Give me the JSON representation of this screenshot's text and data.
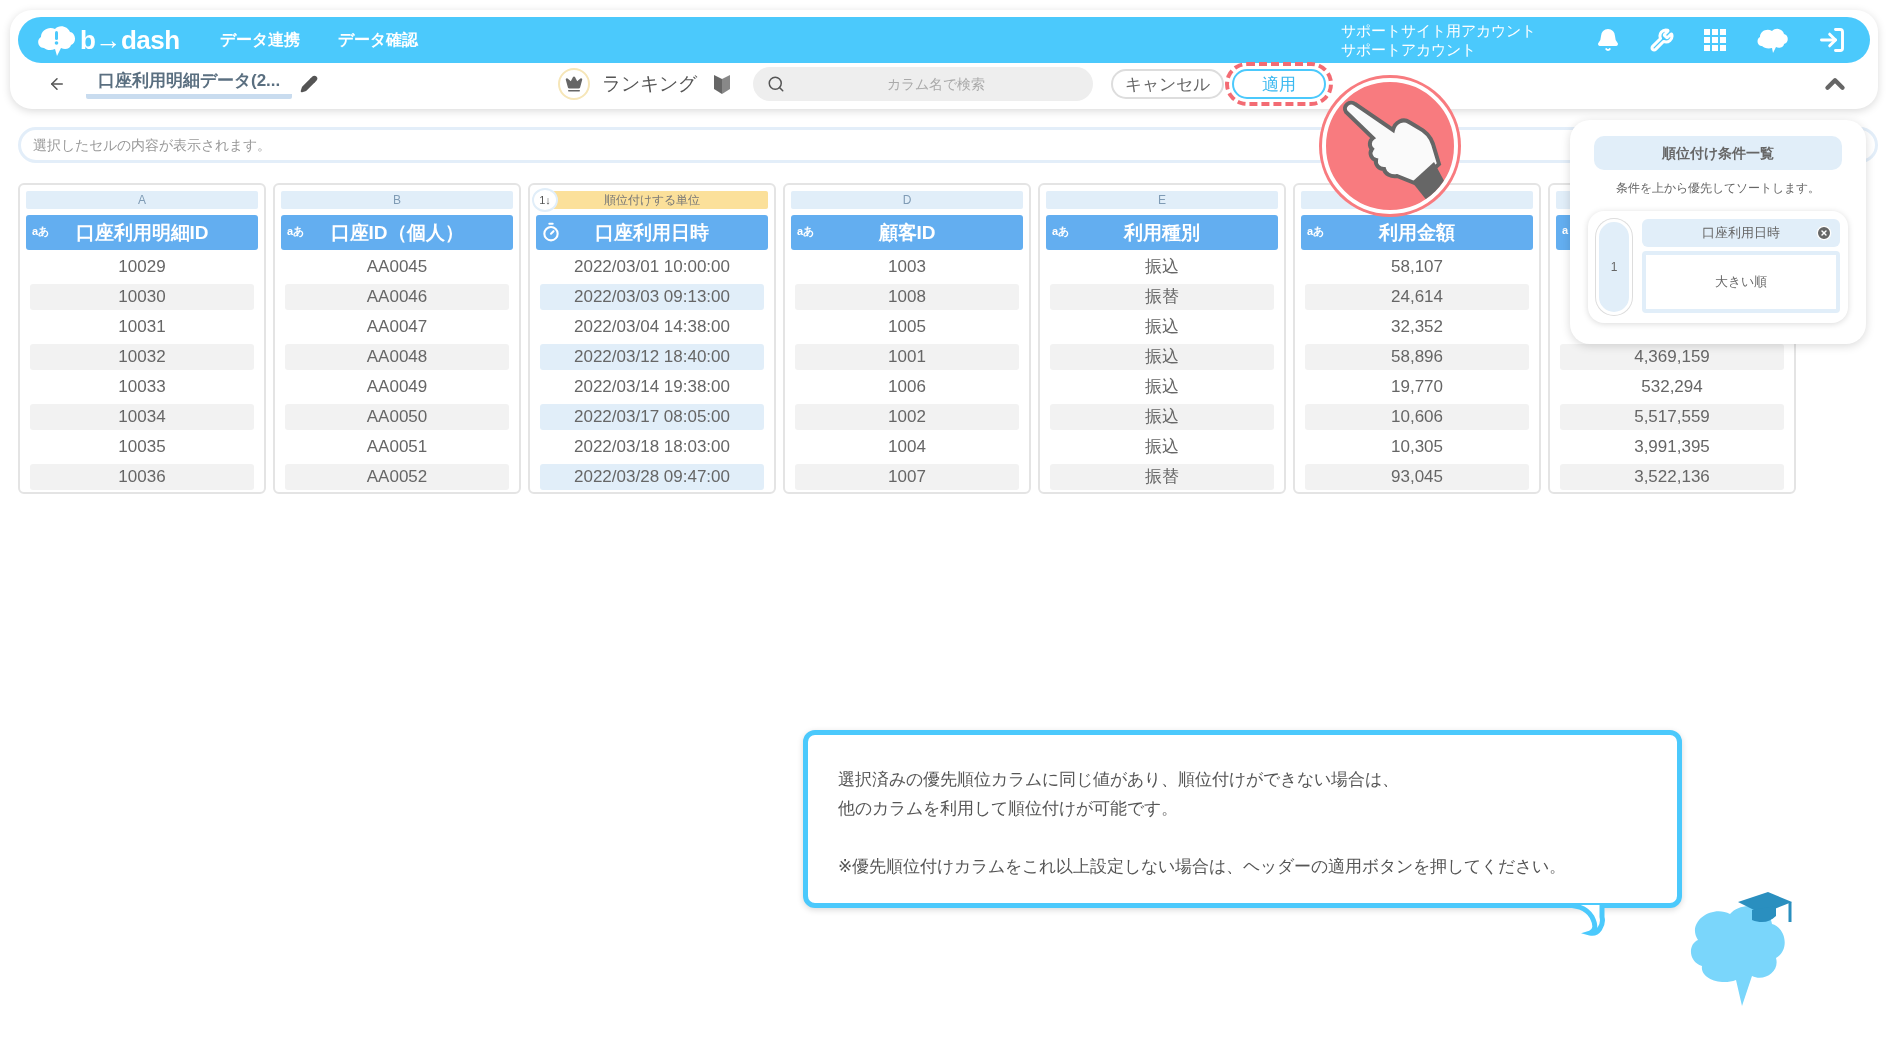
{
  "header": {
    "logo": "b→dash",
    "nav": [
      {
        "label": "データ連携"
      },
      {
        "label": "データ確認"
      }
    ],
    "account": [
      "サポートサイト用アカウント",
      "サポートアカウント"
    ]
  },
  "toolbar": {
    "title": "口座利用明細データ(2...",
    "mode": "ランキング",
    "search": {
      "placeholder": "カラム名で検索"
    },
    "buttons": [
      {
        "label": "キャンセル",
        "highlighted": false
      },
      {
        "label": "適用",
        "highlighted": true
      }
    ]
  },
  "cell_viewer": {
    "placeholder": "選択したセルの内容が表示されます。"
  },
  "table": {
    "columns": [
      {
        "letter": "A",
        "kind": "text",
        "type_badge": "aあ",
        "title": "口座利用明細ID",
        "selected": false,
        "cells": [
          "10029",
          "10030",
          "10031",
          "10032",
          "10033",
          "10034",
          "10035",
          "10036"
        ]
      },
      {
        "letter": "B",
        "kind": "text",
        "type_badge": "aあ",
        "title": "口座ID（個人）",
        "selected": false,
        "cells": [
          "AA0045",
          "AA0046",
          "AA0047",
          "AA0048",
          "AA0049",
          "AA0050",
          "AA0051",
          "AA0052"
        ]
      },
      {
        "rank_label": {
          "order": "1↓",
          "text": "順位付けする単位"
        },
        "kind": "datetime",
        "title": "口座利用日時",
        "selected": true,
        "cells": [
          "2022/03/01 10:00:00",
          "2022/03/03 09:13:00",
          "2022/03/04 14:38:00",
          "2022/03/12 18:40:00",
          "2022/03/14 19:38:00",
          "2022/03/17 08:05:00",
          "2022/03/18 18:03:00",
          "2022/03/28 09:47:00"
        ]
      },
      {
        "letter": "D",
        "kind": "text",
        "type_badge": "aあ",
        "title": "顧客ID",
        "selected": false,
        "cells": [
          "1003",
          "1008",
          "1005",
          "1001",
          "1006",
          "1002",
          "1004",
          "1007"
        ]
      },
      {
        "letter": "E",
        "kind": "text",
        "type_badge": "aあ",
        "title": "利用種別",
        "selected": false,
        "cells": [
          "振込",
          "振替",
          "振込",
          "振込",
          "振込",
          "振込",
          "振込",
          "振替"
        ]
      },
      {
        "kind": "text",
        "type_badge": "aあ",
        "title": "利用金額",
        "selected": false,
        "cells": [
          "58,107",
          "24,614",
          "32,352",
          "58,896",
          "19,770",
          "10,606",
          "10,305",
          "93,045"
        ]
      },
      {
        "kind": "text",
        "type_badge": "a",
        "selected": false,
        "cells": [
          null,
          null,
          null,
          "4,369,159",
          "532,294",
          "5,517,559",
          "3,991,395",
          "3,522,136"
        ]
      }
    ]
  },
  "ranking_panel": {
    "title": "順位付け条件一覧",
    "description": "条件を上から優先してソートします。",
    "conditions": [
      {
        "rank": "1",
        "column": "口座利用日時",
        "order": "大きい順"
      }
    ]
  },
  "tip": {
    "paragraphs": [
      [
        "選択済みの優先順位カラムに同じ値があり、順位付けができない場合は、",
        "他のカラムを利用して順位付けが可能です。"
      ],
      [
        "※優先順位付けカラムをこれ以上設定しない場合は、ヘッダーの適用ボタンを押してください。"
      ]
    ]
  }
}
